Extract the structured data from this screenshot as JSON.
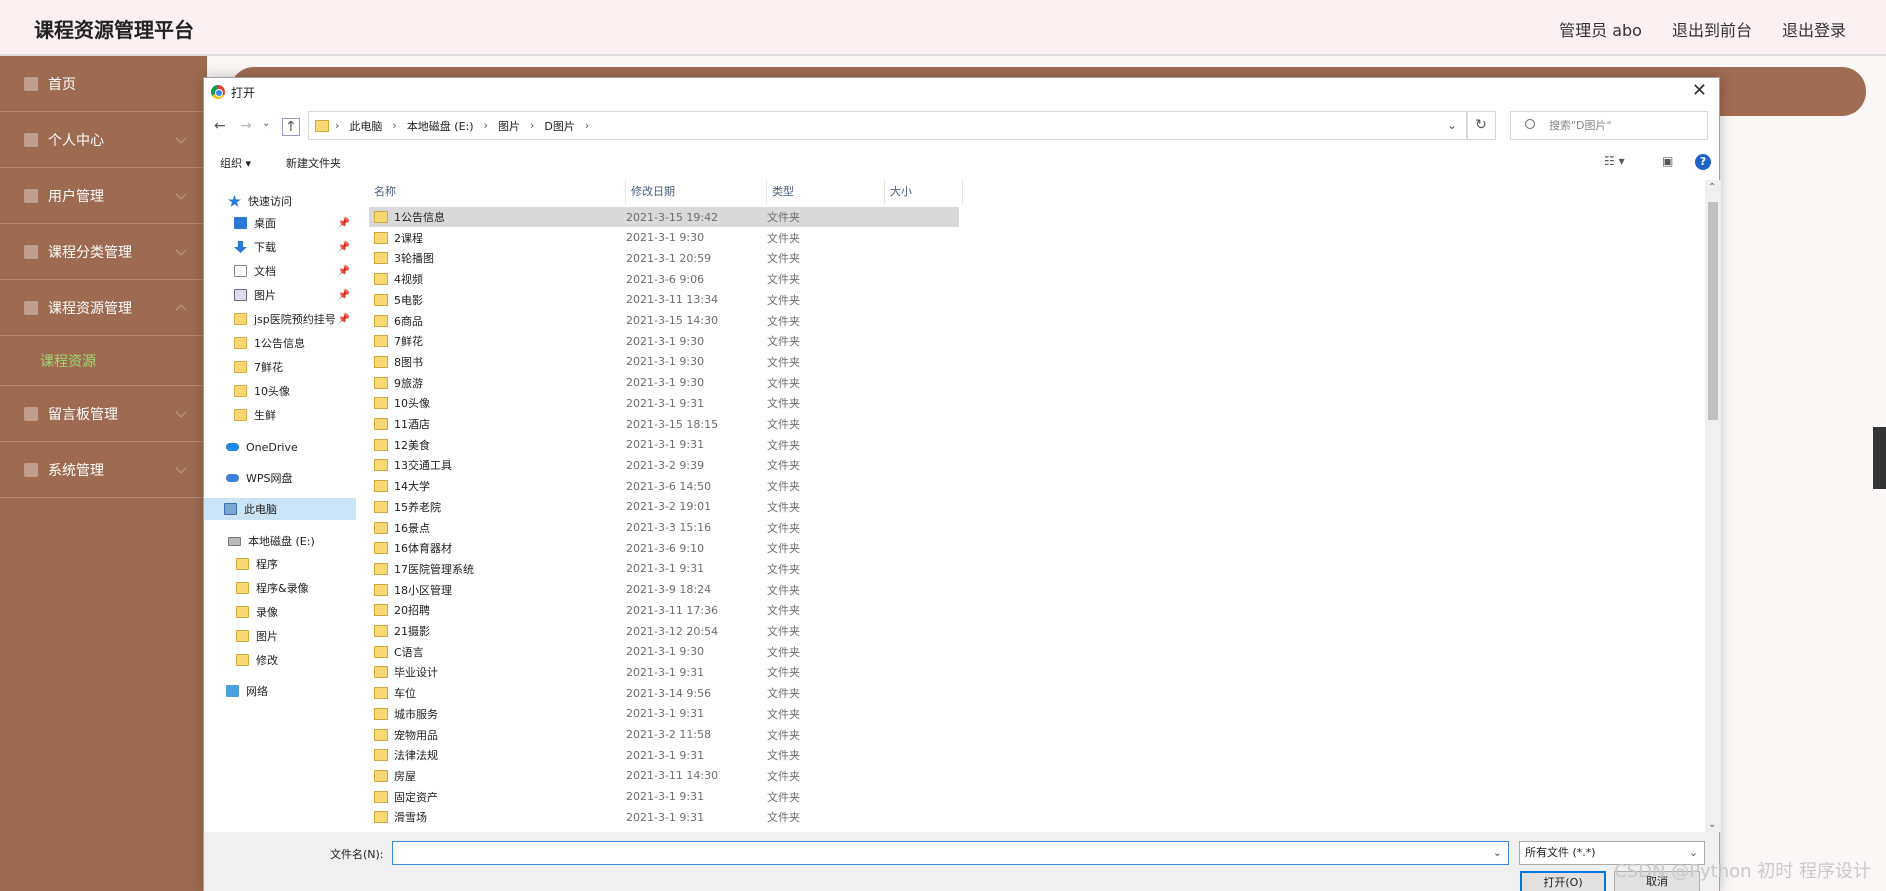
{
  "header": {
    "title": "课程资源管理平台",
    "user": "管理员 abo",
    "back_front": "退出到前台",
    "logout": "退出登录"
  },
  "sidebar": {
    "items": [
      {
        "label": "首页"
      },
      {
        "label": "个人中心"
      },
      {
        "label": "用户管理"
      },
      {
        "label": "课程分类管理"
      },
      {
        "label": "课程资源管理"
      },
      {
        "label": "留言板管理"
      },
      {
        "label": "系统管理"
      }
    ],
    "sub_item": "课程资源"
  },
  "dialog": {
    "title": "打开",
    "close": "✕",
    "path": [
      "此电脑",
      "本地磁盘 (E:)",
      "图片",
      "D图片"
    ],
    "search_placeholder": "搜索\"D图片\"",
    "toolbar": {
      "organize": "组织 ▾",
      "new_folder": "新建文件夹"
    },
    "nav": {
      "quick_access": "快速访问",
      "quick_items": [
        "桌面",
        "下载",
        "文档",
        "图片",
        "jsp医院预约挂号",
        "1公告信息",
        "7鲜花",
        "10头像",
        "生鲜"
      ],
      "onedrive": "OneDrive",
      "wps": "WPS网盘",
      "this_pc": "此电脑",
      "drive": "本地磁盘 (E:)",
      "drive_items": [
        "程序",
        "程序&录像",
        "录像",
        "图片",
        "修改"
      ],
      "network": "网络"
    },
    "columns": {
      "name": "名称",
      "date": "修改日期",
      "type": "类型",
      "size": "大小"
    },
    "files": [
      {
        "name": "1公告信息",
        "date": "2021-3-15 19:42",
        "type": "文件夹"
      },
      {
        "name": "2课程",
        "date": "2021-3-1 9:30",
        "type": "文件夹"
      },
      {
        "name": "3轮播图",
        "date": "2021-3-1 20:59",
        "type": "文件夹"
      },
      {
        "name": "4视频",
        "date": "2021-3-6 9:06",
        "type": "文件夹"
      },
      {
        "name": "5电影",
        "date": "2021-3-11 13:34",
        "type": "文件夹"
      },
      {
        "name": "6商品",
        "date": "2021-3-15 14:30",
        "type": "文件夹"
      },
      {
        "name": "7鲜花",
        "date": "2021-3-1 9:30",
        "type": "文件夹"
      },
      {
        "name": "8图书",
        "date": "2021-3-1 9:30",
        "type": "文件夹"
      },
      {
        "name": "9旅游",
        "date": "2021-3-1 9:30",
        "type": "文件夹"
      },
      {
        "name": "10头像",
        "date": "2021-3-1 9:31",
        "type": "文件夹"
      },
      {
        "name": "11酒店",
        "date": "2021-3-15 18:15",
        "type": "文件夹"
      },
      {
        "name": "12美食",
        "date": "2021-3-1 9:31",
        "type": "文件夹"
      },
      {
        "name": "13交通工具",
        "date": "2021-3-2 9:39",
        "type": "文件夹"
      },
      {
        "name": "14大学",
        "date": "2021-3-6 14:50",
        "type": "文件夹"
      },
      {
        "name": "15养老院",
        "date": "2021-3-2 19:01",
        "type": "文件夹"
      },
      {
        "name": "16景点",
        "date": "2021-3-3 15:16",
        "type": "文件夹"
      },
      {
        "name": "16体育器材",
        "date": "2021-3-6 9:10",
        "type": "文件夹"
      },
      {
        "name": "17医院管理系统",
        "date": "2021-3-1 9:31",
        "type": "文件夹"
      },
      {
        "name": "18小区管理",
        "date": "2021-3-9 18:24",
        "type": "文件夹"
      },
      {
        "name": "20招聘",
        "date": "2021-3-11 17:36",
        "type": "文件夹"
      },
      {
        "name": "21摄影",
        "date": "2021-3-12 20:54",
        "type": "文件夹"
      },
      {
        "name": "C语言",
        "date": "2021-3-1 9:30",
        "type": "文件夹"
      },
      {
        "name": "毕业设计",
        "date": "2021-3-1 9:31",
        "type": "文件夹"
      },
      {
        "name": "车位",
        "date": "2021-3-14 9:56",
        "type": "文件夹"
      },
      {
        "name": "城市服务",
        "date": "2021-3-1 9:31",
        "type": "文件夹"
      },
      {
        "name": "宠物用品",
        "date": "2021-3-2 11:58",
        "type": "文件夹"
      },
      {
        "name": "法律法规",
        "date": "2021-3-1 9:31",
        "type": "文件夹"
      },
      {
        "name": "房屋",
        "date": "2021-3-11 14:30",
        "type": "文件夹"
      },
      {
        "name": "固定资产",
        "date": "2021-3-1 9:31",
        "type": "文件夹"
      },
      {
        "name": "滑雪场",
        "date": "2021-3-1 9:31",
        "type": "文件夹"
      }
    ],
    "filename_label": "文件名(N):",
    "filename_value": "",
    "filetype": "所有文件 (*.*)",
    "open": "打开(O)",
    "cancel": "取消"
  },
  "watermark": "CSDN @Python 初时 程序设计"
}
